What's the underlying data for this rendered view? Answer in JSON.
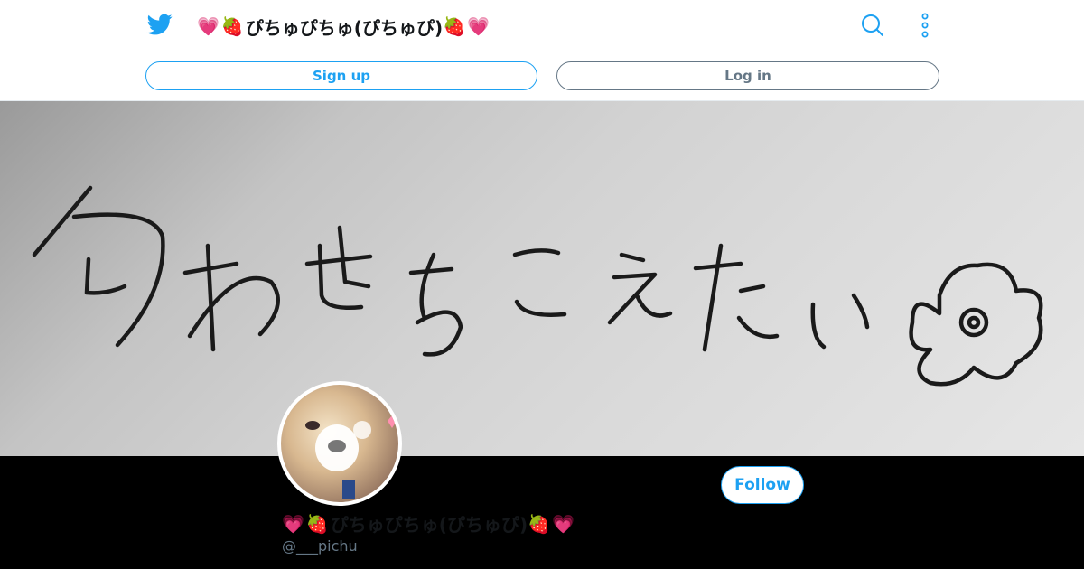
{
  "header": {
    "name_prefix_emoji": [
      "💗",
      "🍓"
    ],
    "name": "ぴちゅぴちゅ(ぴちゅぴ)",
    "name_suffix_emoji": [
      "🍓",
      "💗"
    ],
    "icons": [
      "twitter-bird-icon",
      "search-icon",
      "more-options-icon"
    ]
  },
  "actions": {
    "signup_label": "Sign up",
    "login_label": "Log in",
    "follow_label": "Follow"
  },
  "banner": {
    "handwritten_text": "匂わせをこえたい"
  },
  "profile": {
    "name_prefix_emoji": [
      "💗",
      "🍓"
    ],
    "name": "ぴちゅぴちゅ(ぴちゅぴ)",
    "name_suffix_emoji": [
      "🍓",
      "💗"
    ],
    "handle": "@___pichu"
  },
  "colors": {
    "brand_blue": "#1da1f2",
    "muted_gray": "#657786",
    "text_dark": "#14171a",
    "profile_bg": "#000000"
  }
}
